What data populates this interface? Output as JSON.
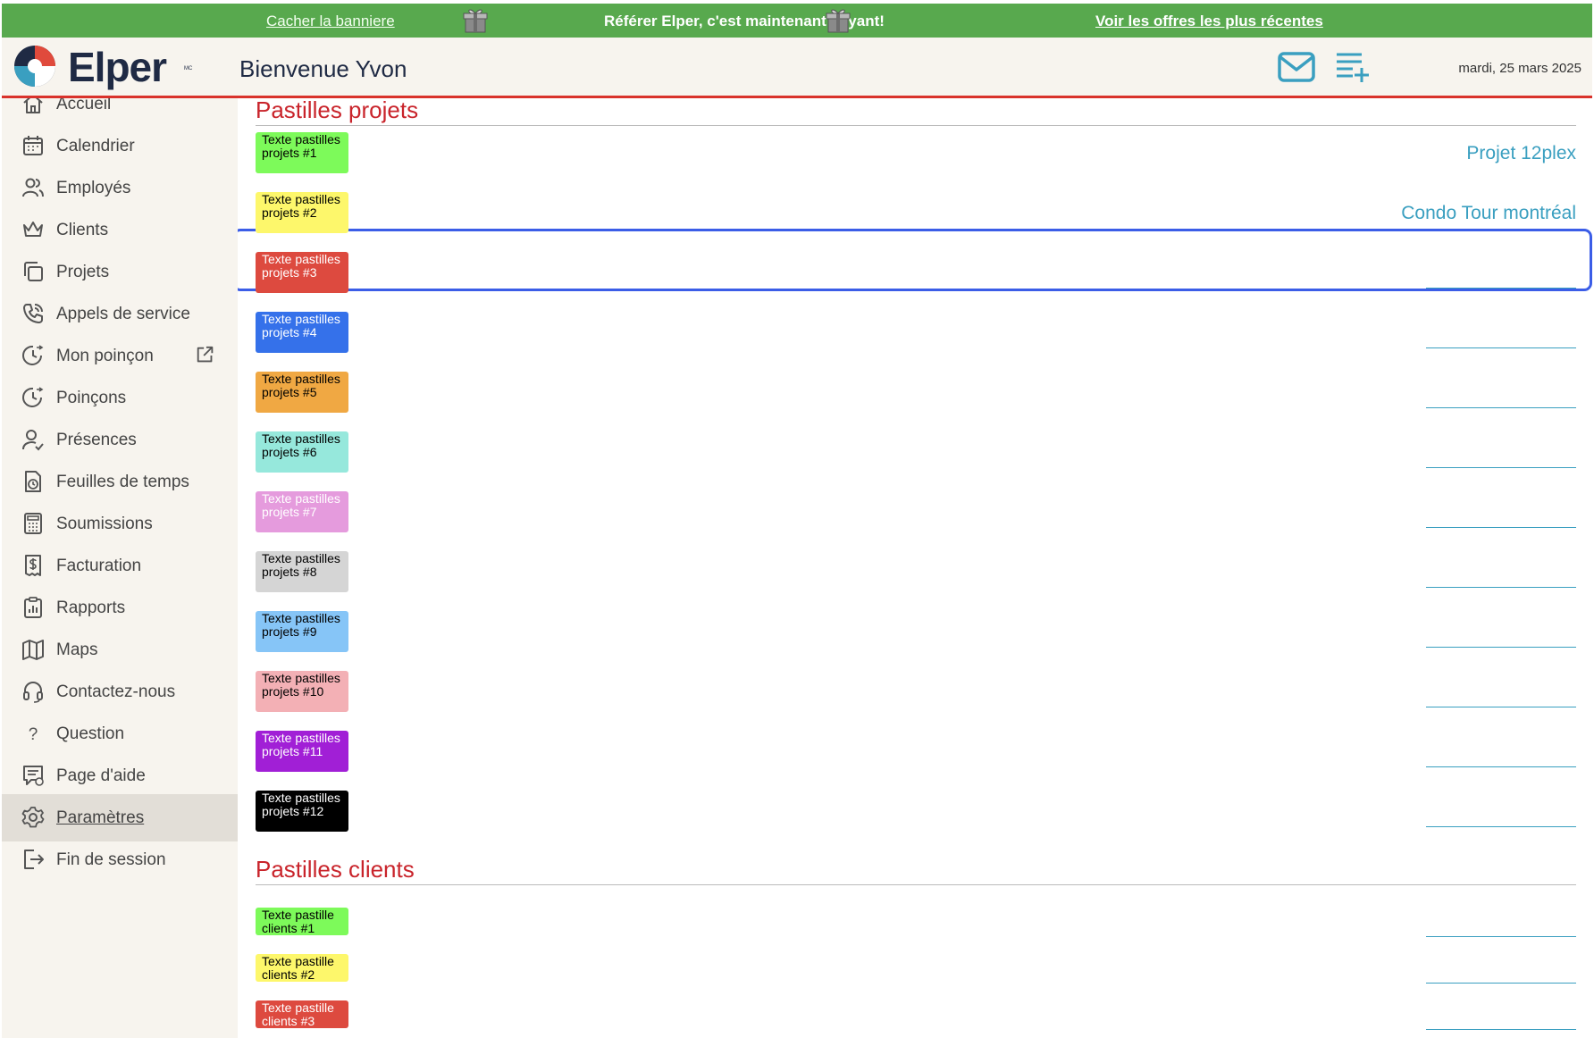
{
  "banner": {
    "hide_label": "Cacher la banniere",
    "message": "Référer Elper, c'est maintenant payant!",
    "offers_label": "Voir les offres les plus récentes",
    "gift_icon": "gift-icon"
  },
  "header": {
    "logo_text": "Elper",
    "logo_mark": "MC",
    "welcome": "Bienvenue Yvon",
    "date": "mardi, 25 mars 2025",
    "mail_icon": "mail-icon",
    "add_list_icon": "add-list-icon"
  },
  "sidebar": {
    "items": [
      {
        "label": "Accueil",
        "icon": "home-icon"
      },
      {
        "label": "Calendrier",
        "icon": "calendar-icon"
      },
      {
        "label": "Employés",
        "icon": "users-icon"
      },
      {
        "label": "Clients",
        "icon": "crown-icon"
      },
      {
        "label": "Projets",
        "icon": "copy-icon"
      },
      {
        "label": "Appels de service",
        "icon": "phone-icon"
      },
      {
        "label": "Mon poinçon",
        "icon": "clock-icon"
      },
      {
        "label": "Poinçons",
        "icon": "clock-icon"
      },
      {
        "label": "Présences",
        "icon": "user-check-icon"
      },
      {
        "label": "Feuilles de temps",
        "icon": "timesheet-icon"
      },
      {
        "label": "Soumissions",
        "icon": "calculator-icon"
      },
      {
        "label": "Facturation",
        "icon": "invoice-icon"
      },
      {
        "label": "Rapports",
        "icon": "clipboard-icon"
      },
      {
        "label": "Maps",
        "icon": "map-icon"
      },
      {
        "label": "Contactez-nous",
        "icon": "headset-icon"
      },
      {
        "label": "Question",
        "icon": "question-icon"
      },
      {
        "label": "Page d'aide",
        "icon": "help-chat-icon"
      },
      {
        "label": "Paramètres",
        "icon": "gear-icon",
        "active": true
      },
      {
        "label": "Fin de session",
        "icon": "logout-icon"
      }
    ]
  },
  "projects": {
    "title": "Pastilles projets",
    "rows": [
      {
        "text": "Texte pastilles projets #1",
        "bg": "#7dfa5a",
        "fg": "#000000",
        "project": "Projet 12plex"
      },
      {
        "text": "Texte pastilles projets #2",
        "bg": "#fdf76b",
        "fg": "#000000",
        "project": "Condo Tour montréal"
      },
      {
        "text": "Texte pastilles projets #3",
        "bg": "#dd4a3f",
        "fg": "#ffffff",
        "project": ""
      },
      {
        "text": "Texte pastilles projets #4",
        "bg": "#3571ea",
        "fg": "#ffffff",
        "project": ""
      },
      {
        "text": "Texte pastilles projets #5",
        "bg": "#f0a843",
        "fg": "#000000",
        "project": ""
      },
      {
        "text": "Texte pastilles projets #6",
        "bg": "#96e8dc",
        "fg": "#000000",
        "project": ""
      },
      {
        "text": "Texte pastilles projets #7",
        "bg": "#e59bdd",
        "fg": "#ffffff",
        "project": ""
      },
      {
        "text": "Texte pastilles projets #8",
        "bg": "#d5d5d5",
        "fg": "#000000",
        "project": ""
      },
      {
        "text": "Texte pastilles projets #9",
        "bg": "#86c5f7",
        "fg": "#000000",
        "project": ""
      },
      {
        "text": "Texte pastilles projets #10",
        "bg": "#f3b0b5",
        "fg": "#000000",
        "project": ""
      },
      {
        "text": "Texte pastilles projets #11",
        "bg": "#a11fd6",
        "fg": "#ffffff",
        "project": ""
      },
      {
        "text": "Texte pastilles projets #12",
        "bg": "#000000",
        "fg": "#ffffff",
        "project": ""
      }
    ]
  },
  "clients": {
    "title": "Pastilles clients",
    "rows": [
      {
        "text": "Texte pastille clients #1",
        "bg": "#7dfa5a",
        "fg": "#000000"
      },
      {
        "text": "Texte pastille clients #2",
        "bg": "#fdf76b",
        "fg": "#000000"
      },
      {
        "text": "Texte pastille clients #3",
        "bg": "#dd4a3f",
        "fg": "#ffffff"
      }
    ]
  },
  "colors": {
    "banner_green": "#58a94e",
    "accent_red": "#c9242b",
    "link_blue": "#3a9fc0",
    "highlight_blue": "#3b5de7"
  }
}
